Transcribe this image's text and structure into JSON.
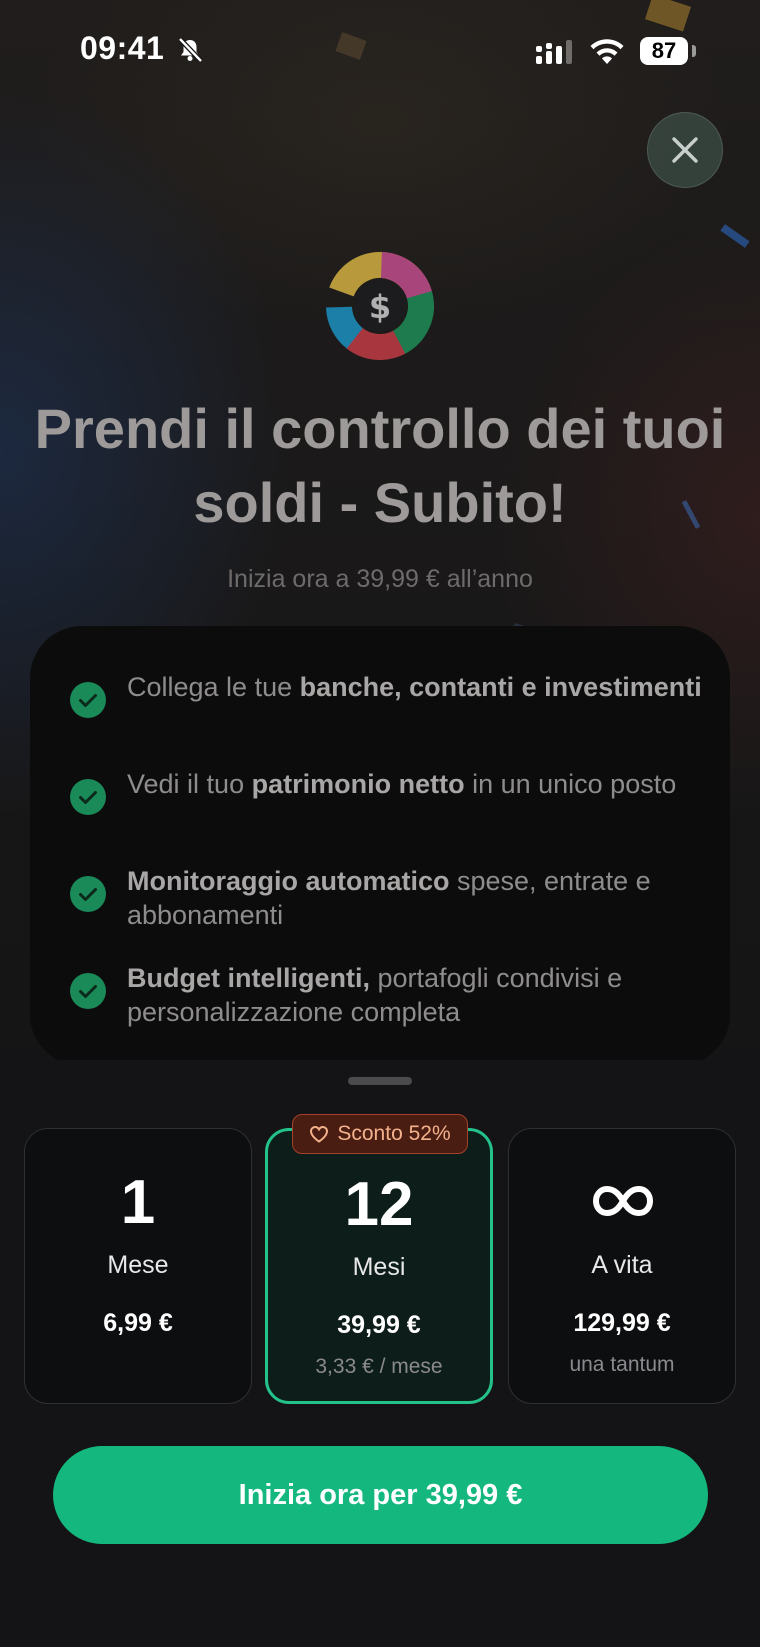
{
  "status_bar": {
    "time": "09:41",
    "battery": "87",
    "icons": [
      "bell-slash-icon",
      "cellular-signal-icon",
      "wifi-icon",
      "battery-icon"
    ]
  },
  "close_icon": "close-icon",
  "logo_icon": "dollar-icon",
  "headline": "Prendi il controllo dei tuoi soldi - Subito!",
  "subheadline": "Inizia ora a 39,99 € all’anno",
  "features": [
    {
      "bold_first": false,
      "normal_before": "Collega le tue ",
      "bold": "banche, contanti e investimenti",
      "normal_after": ""
    },
    {
      "bold_first": false,
      "normal_before": "Vedi il tuo ",
      "bold": "patrimonio netto",
      "normal_after": " in un unico posto"
    },
    {
      "bold_first": true,
      "normal_before": "",
      "bold": "Monitoraggio automatico",
      "normal_after": " spese, entrate e abbonamenti"
    },
    {
      "bold_first": true,
      "normal_before": "",
      "bold": "Budget intelligenti,",
      "normal_after": " portafogli condivisi e personalizzazione completa"
    }
  ],
  "plans": [
    {
      "count": "1",
      "period": "Mese",
      "price": "6,99 €",
      "note": "",
      "selected": false
    },
    {
      "count": "12",
      "period": "Mesi",
      "price": "39,99 €",
      "note": "3,33 € / mese",
      "selected": true
    },
    {
      "count": "∞",
      "period": "A vita",
      "price": "129,99 €",
      "note": "una tantum",
      "selected": false
    }
  ],
  "discount_badge": "Sconto 52%",
  "cta_label": "Inizia ora per 39,99 €",
  "colors": {
    "accent": "#14b87f",
    "selected_border": "#22c28a",
    "badge_bg": "#4a1d12",
    "badge_text": "#f3b18b",
    "check": "#1a8a58"
  }
}
